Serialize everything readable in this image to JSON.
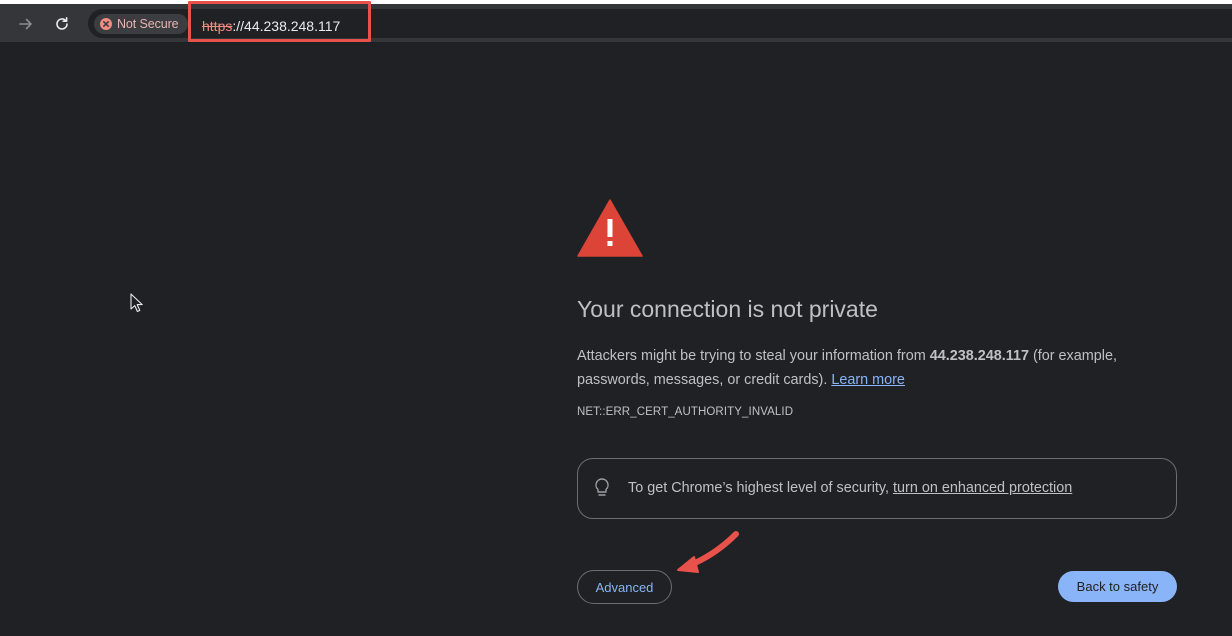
{
  "browser": {
    "security_chip_label": "Not Secure",
    "url_scheme": "https",
    "url_rest": "://44.238.248.117",
    "icons": {
      "forward": "forward-arrow-icon",
      "reload": "reload-icon",
      "security": "not-secure-icon"
    }
  },
  "interstitial": {
    "heading": "Your connection is not private",
    "desc_before": "Attackers might be trying to steal your information from ",
    "desc_host": "44.238.248.117",
    "desc_after": " (for example, passwords, messages, or credit cards). ",
    "learn_more": "Learn more",
    "error_code": "NET::ERR_CERT_AUTHORITY_INVALID",
    "enhanced_text": "To get Chrome’s highest level of security, ",
    "enhanced_link": "turn on enhanced protection",
    "advanced_button": "Advanced",
    "back_button": "Back to safety"
  },
  "colors": {
    "background": "#202124",
    "warning_red": "#db4437",
    "link_blue": "#8ab4f8",
    "annotation_red": "#e8524a"
  }
}
